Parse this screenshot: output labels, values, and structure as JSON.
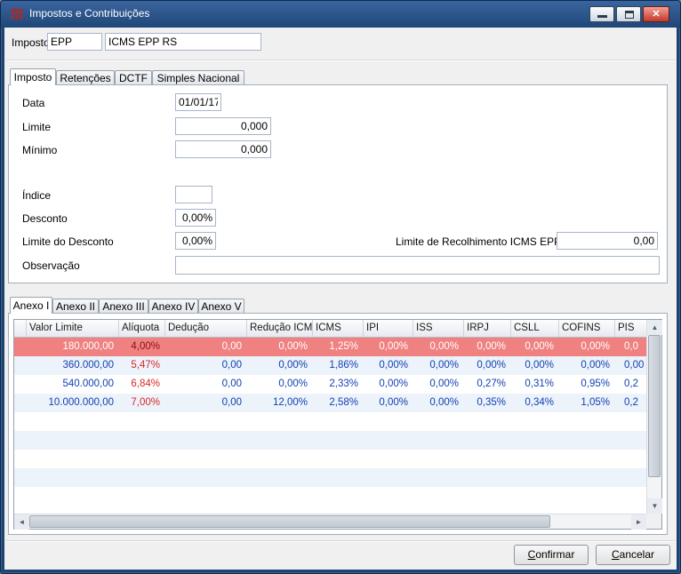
{
  "titlebar": {
    "title": "Impostos e Contribuições",
    "close_glyph": "✕"
  },
  "header": {
    "label": "Imposto",
    "code": "EPP",
    "description": "ICMS EPP RS"
  },
  "main_tabs": {
    "imposto": "Imposto",
    "retencoes": "Retenções",
    "dctf": "DCTF",
    "simples": "Simples Nacional"
  },
  "form": {
    "data": {
      "label": "Data",
      "value": "01/01/17"
    },
    "limite": {
      "label": "Limite",
      "value": "0,000"
    },
    "minimo": {
      "label": "Mínimo",
      "value": "0,000"
    },
    "indice": {
      "label": "Índice",
      "value": ""
    },
    "desconto": {
      "label": "Desconto",
      "value": "0,00%"
    },
    "limite_desconto": {
      "label": "Limite do Desconto",
      "value": "0,00%"
    },
    "limite_recolhimento": {
      "label": "Limite de Recolhimento ICMS EPP",
      "value": "0,00"
    },
    "observacao": {
      "label": "Observação",
      "value": ""
    }
  },
  "anexo_tabs": {
    "a1": "Anexo I",
    "a2": "Anexo II",
    "a3": "Anexo III",
    "a4": "Anexo IV",
    "a5": "Anexo V"
  },
  "grid": {
    "columns": [
      "Valor Limite",
      "Alíquota",
      "Dedução",
      "Redução ICMS",
      "ICMS",
      "IPI",
      "ISS",
      "IRPJ",
      "CSLL",
      "COFINS",
      "PIS"
    ],
    "rows": [
      {
        "selected": true,
        "cells": [
          "180.000,00",
          "4,00%",
          "0,00",
          "0,00%",
          "1,25%",
          "0,00%",
          "0,00%",
          "0,00%",
          "0,00%",
          "0,00%",
          "0,0"
        ]
      },
      {
        "selected": false,
        "cells": [
          "360.000,00",
          "5,47%",
          "0,00",
          "0,00%",
          "1,86%",
          "0,00%",
          "0,00%",
          "0,00%",
          "0,00%",
          "0,00%",
          "0,00"
        ]
      },
      {
        "selected": false,
        "cells": [
          "540.000,00",
          "6,84%",
          "0,00",
          "0,00%",
          "2,33%",
          "0,00%",
          "0,00%",
          "0,27%",
          "0,31%",
          "0,95%",
          "0,2"
        ]
      },
      {
        "selected": false,
        "cells": [
          "10.000.000,00",
          "7,00%",
          "0,00",
          "12,00%",
          "2,58%",
          "0,00%",
          "0,00%",
          "0,35%",
          "0,34%",
          "1,05%",
          "0,2"
        ]
      }
    ]
  },
  "scrollbar": {
    "up": "▲",
    "down": "▼",
    "left": "◄",
    "right": "►"
  },
  "footer": {
    "confirm": "Confirmar",
    "cancel": "Cancelar"
  },
  "colors": {
    "selected_row": "#ef8181",
    "value_text": "#1240b4",
    "aliquota_text": "#d42a2a",
    "frame": "#1d4473"
  }
}
